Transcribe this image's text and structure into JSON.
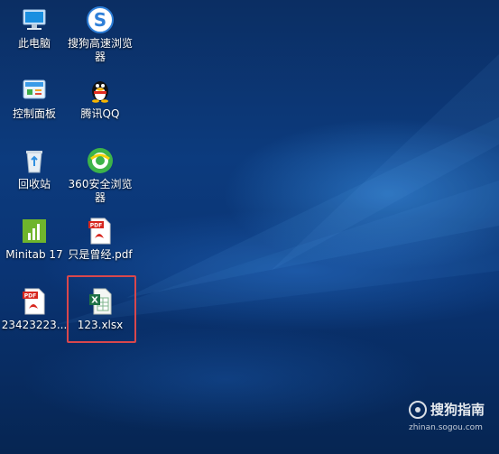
{
  "desktop": {
    "icons": [
      {
        "label": "此电脑",
        "icon": "computer-icon"
      },
      {
        "label": "搜狗高速浏览器",
        "icon": "sogou-browser-icon"
      },
      {
        "label": "控制面板",
        "icon": "control-panel-icon"
      },
      {
        "label": "腾讯QQ",
        "icon": "qq-penguin-icon"
      },
      {
        "label": "回收站",
        "icon": "recycle-bin-icon"
      },
      {
        "label": "360安全浏览器",
        "icon": "360-browser-icon"
      },
      {
        "label": "Minitab 17",
        "icon": "minitab-icon"
      },
      {
        "label": "只是曾经.pdf",
        "icon": "pdf-file-icon"
      },
      {
        "label": "23423223...",
        "icon": "pdf-file-icon"
      },
      {
        "label": "123.xlsx",
        "icon": "excel-file-icon"
      }
    ],
    "highlight_color": "#d9474c"
  },
  "watermark": {
    "brand": "搜狗指南",
    "url": "zhinan.sogou.com"
  }
}
